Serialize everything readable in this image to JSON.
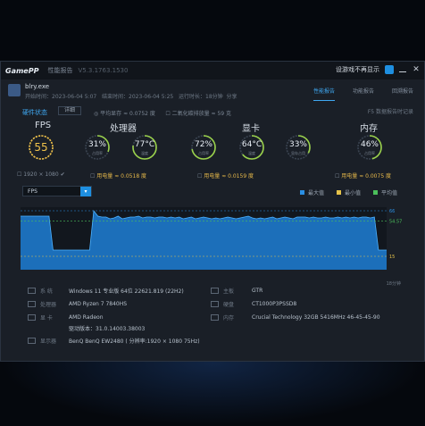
{
  "titlebar": {
    "logo": "GamePP",
    "menu": "性能报告",
    "version": "V5.3.1763.1530",
    "noshow_label": "设游戏不再显示"
  },
  "header": {
    "app_name": "blry.exe",
    "start_time": "开始时间：2023-06-04 5:07",
    "end_time": "结束时间：2023-06-04 5:25",
    "duration": "运行时长：18分钟",
    "share": "分享",
    "tabs": [
      "性能报告",
      "功能报告",
      "回溯报告"
    ],
    "active_tab_index": 0,
    "perf_label": "硬件状态",
    "details_button": "详细",
    "peak_gpu": "平均显存 ≈ 0.0752 度",
    "peak_fps": "二氧化碳排放量 ≈ 59 克",
    "export_link": "F5 数据报告时记录"
  },
  "sections": {
    "fps": "FPS",
    "cpu": "处理器",
    "gpu": "显卡",
    "mem": "内存"
  },
  "gauges": {
    "fps": {
      "value": "55",
      "sub": "1920 × 1080",
      "sub_check": "✔"
    },
    "cpu_usage": {
      "value": "31%",
      "label": "占用率",
      "level": 0.31
    },
    "cpu_temp": {
      "value": "77°C",
      "label": "温度",
      "level": 0.77
    },
    "gpu_usage": {
      "value": "72%",
      "label": "占用率",
      "level": 0.72
    },
    "gpu_temp": {
      "value": "64°C",
      "label": "温度",
      "level": 0.64
    },
    "gpu_mem": {
      "value": "33%",
      "label": "显存占用",
      "level": 0.33
    },
    "mem_usage": {
      "value": "46%",
      "label": "占用率",
      "level": 0.46
    }
  },
  "stats": {
    "cpu_power": "用电量 ≈ 0.0518 度",
    "gpu_power": "用电量 ≈ 0.0159 度",
    "mem_power": "用电量 ≈ 0.0075 度"
  },
  "chart": {
    "select": "FPS",
    "legend": [
      {
        "name": "最大值",
        "color": "#2a8fe4"
      },
      {
        "name": "最小值",
        "color": "#e6c34a"
      },
      {
        "name": "平均值",
        "color": "#4bbf5b"
      }
    ],
    "y_max_label": "66",
    "y_avg_label": "54.57",
    "y_min_label": "15",
    "time_label": "18分钟"
  },
  "chart_data": {
    "type": "area",
    "series": [
      {
        "name": "FPS",
        "values": [
          60,
          60,
          60,
          60,
          60,
          60,
          60,
          60,
          22,
          22,
          22,
          22,
          22,
          22,
          22,
          22,
          22,
          22,
          66,
          60,
          59,
          59,
          57,
          58,
          60,
          57,
          58,
          59,
          59,
          60,
          58,
          59,
          59,
          58,
          59,
          59,
          58,
          59,
          58,
          59,
          57,
          58,
          59,
          57,
          58,
          59,
          58,
          57,
          58,
          57,
          58,
          59,
          58,
          57,
          58,
          59,
          60,
          58,
          57,
          58,
          57,
          58,
          59,
          57,
          58,
          59,
          58,
          57,
          59,
          59,
          59,
          58,
          59,
          58,
          58,
          59,
          58,
          58,
          59,
          58,
          59,
          58,
          59,
          58,
          59,
          59,
          58,
          59,
          22,
          22,
          22
        ]
      }
    ],
    "max": 66,
    "avg": 54.57,
    "min": 15,
    "ylim": [
      0,
      70
    ]
  },
  "system": {
    "os_k": "系 统",
    "os_v": "Windows 11 专业版 64位 22621.819 (22H2)",
    "cpu_k": "处理器",
    "cpu_v": "AMD Ryzen 7 7840HS",
    "gpu_k": "显 卡",
    "gpu_v": "AMD Radeon",
    "driver_v": "驱动版本：31.0.14003.38003",
    "mon_k": "显示器",
    "mon_v": "BenQ BenQ EW2480 ( 分辨率:1920 × 1080 75Hz)",
    "board_k": "主板",
    "board_v": "GTR",
    "disk_k": "硬盘",
    "disk_v": "CT1000P3PSSD8",
    "ram_k": "内存",
    "ram_v": "Crucial Technology 32GB 5416MHz 46-45-45-90"
  }
}
